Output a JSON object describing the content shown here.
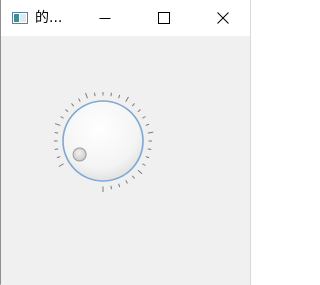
{
  "window": {
    "title": "的...",
    "buttons": {
      "minimize": "minimize",
      "maximize": "maximize",
      "close": "close"
    }
  },
  "dial": {
    "value_fraction": 0.0,
    "ticks": 30
  },
  "icons": {
    "app": "app-icon",
    "minimize": "minimize-icon",
    "maximize": "maximize-icon",
    "close": "close-icon"
  },
  "colors": {
    "knob_ring": "#7fa7d2",
    "knob_face": "#f7f7f7",
    "tick": "#7a7a7a"
  }
}
